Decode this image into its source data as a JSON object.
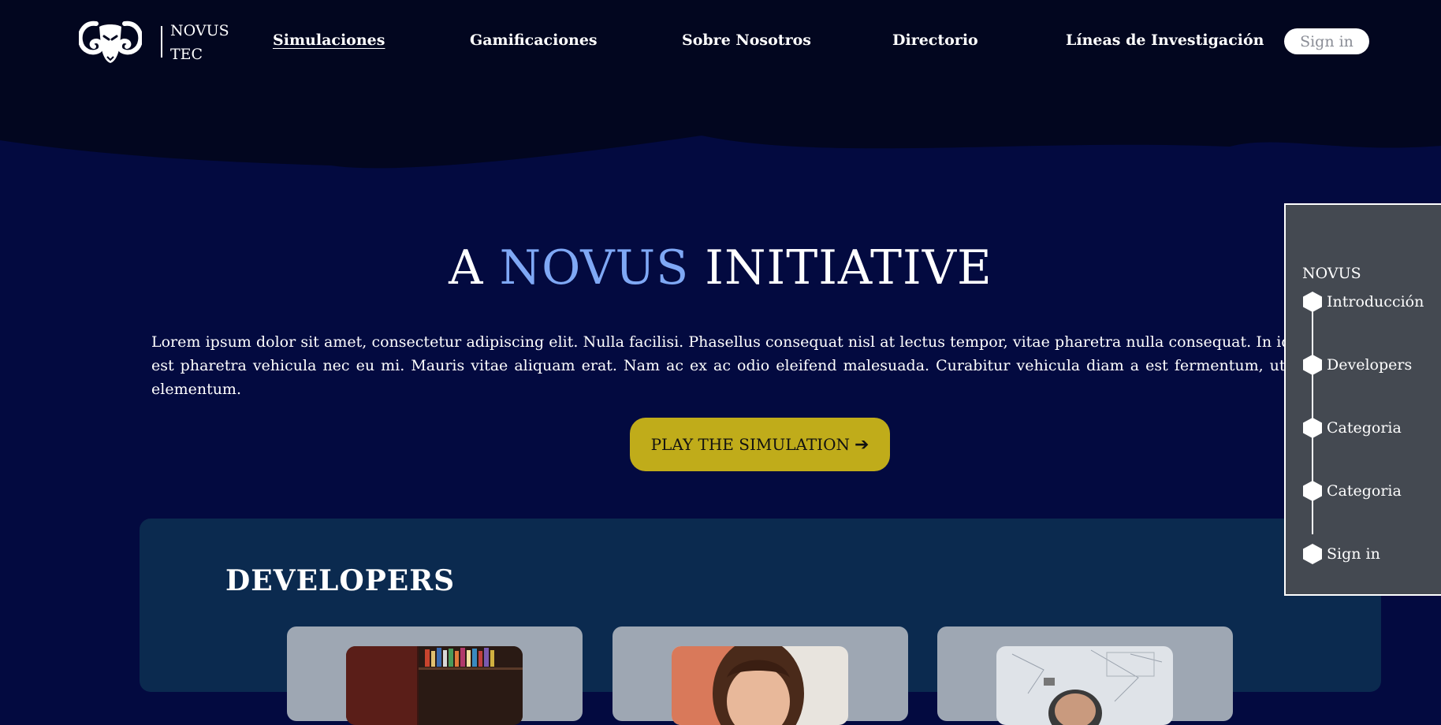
{
  "header": {
    "brand": [
      "NOVUS",
      "TEC"
    ],
    "nav": [
      "Simulaciones",
      "Gamificaciones",
      "Sobre Nosotros",
      "Directorio",
      "Líneas de Investigación"
    ],
    "active_nav": "Simulaciones",
    "signin_label": "Sign in",
    "logo_icon": "ram-head-icon"
  },
  "hero": {
    "title_prefix": "A",
    "title_accent": "NOVUS",
    "title_suffix": "INITIATIVE",
    "paragraph": "Lorem ipsum dolor sit amet, consectetur adipiscing elit. Nulla facilisi. Phasellus consequat nisl at lectus tempor, vitae pharetra nulla consequat. In id turpis sed est pharetra vehicula nec eu mi. Mauris vitae aliquam erat. Nam ac ex ac odio eleifend malesuada. Curabitur vehicula diam a est fermentum, ut varius nisi elementum.",
    "play_label": "PLAY THE SIMULATION",
    "play_icon": "arrow-right-icon"
  },
  "developers": {
    "title": "DEVELOPERS",
    "cards": [
      {
        "photo": "developer-photo-1"
      },
      {
        "photo": "developer-photo-2"
      },
      {
        "photo": "developer-photo-3"
      }
    ]
  },
  "side_nav": {
    "title": "NOVUS",
    "items": [
      "Introducción",
      "Developers",
      "Categoria",
      "Categoria",
      "Sign in"
    ],
    "item_icon": "hexagon-icon"
  },
  "colors": {
    "background": "#030a40",
    "header_background": "#02061f",
    "accent": "#7fa8f5",
    "play_button": "#c0ac1a",
    "developer_section": "#0b2a4f",
    "developer_card": "#9ea7b3",
    "side_panel": "#444951"
  }
}
